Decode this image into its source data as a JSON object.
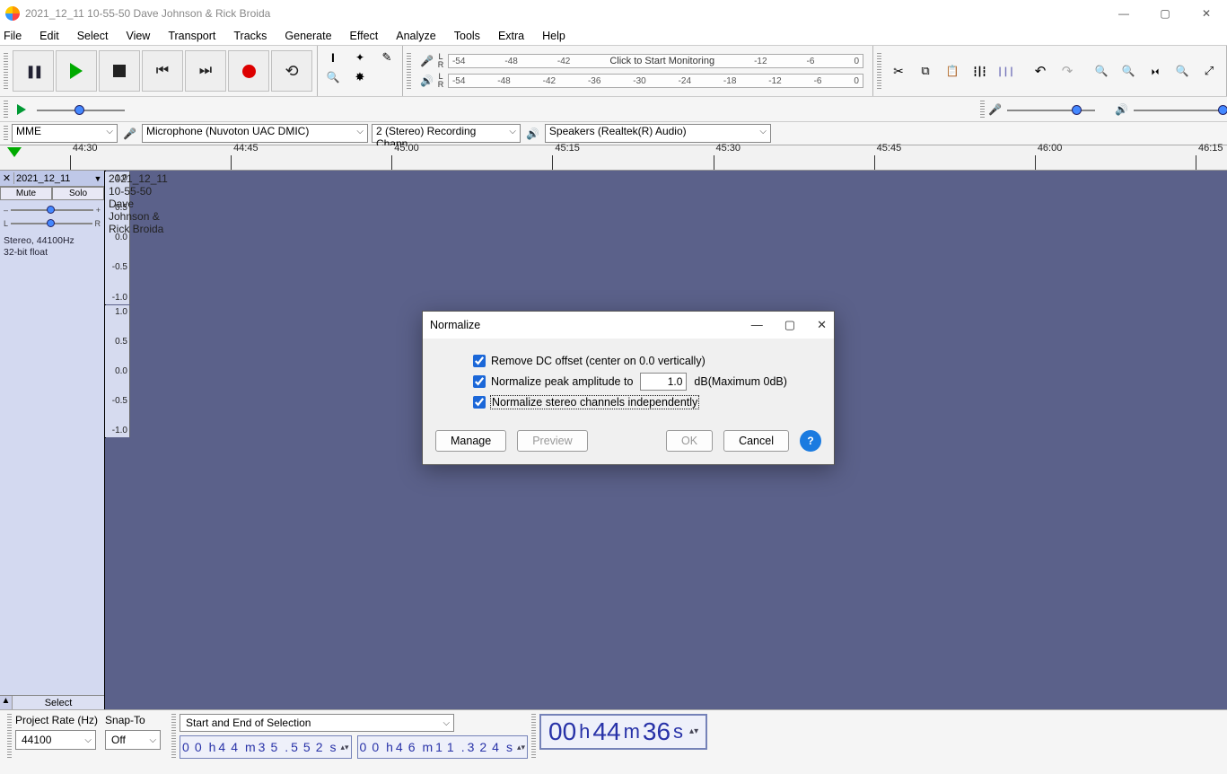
{
  "title": "2021_12_11 10-55-50 Dave  Johnson  & Rick Broida",
  "menu": [
    "File",
    "Edit",
    "Select",
    "View",
    "Transport",
    "Tracks",
    "Generate",
    "Effect",
    "Analyze",
    "Tools",
    "Extra",
    "Help"
  ],
  "meter_ticks": [
    "-54",
    "-48",
    "-42",
    "-36",
    "-30",
    "-24",
    "-18",
    "-12",
    "-6",
    "0"
  ],
  "meter_prompt": "Click to Start Monitoring",
  "devices": {
    "host": "MME",
    "input": "Microphone (Nuvoton UAC DMIC)",
    "channels": "2 (Stereo) Recording Chann",
    "output": "Speakers (Realtek(R) Audio)"
  },
  "timeline": {
    "labels": [
      "44:30",
      "44:45",
      "45:00",
      "45:15",
      "45:30",
      "45:45",
      "46:00",
      "46:15"
    ]
  },
  "track": {
    "name_short": "2021_12_11",
    "title": "2021_12_11 10-55-50 Dave  Johnson  & Rick Broida",
    "mute": "Mute",
    "solo": "Solo",
    "pan_l": "L",
    "pan_r": "R",
    "info1": "Stereo, 44100Hz",
    "info2": "32-bit float",
    "select": "Select",
    "vscale": [
      "1.0",
      "0.5",
      "0.0",
      "-0.5",
      "-1.0"
    ]
  },
  "dialog": {
    "title": "Normalize",
    "opt1": "Remove DC offset (center on 0.0 vertically)",
    "opt2": "Normalize peak amplitude to",
    "opt2_value": "1.0",
    "opt2_suffix": "dB(Maximum 0dB)",
    "opt3": "Normalize stereo channels independently",
    "manage": "Manage",
    "preview": "Preview",
    "ok": "OK",
    "cancel": "Cancel"
  },
  "bottom": {
    "rate_label": "Project Rate (Hz)",
    "rate": "44100",
    "snap_label": "Snap-To",
    "snap": "Off",
    "sel_label": "Start and End of Selection",
    "sel_start": {
      "h": "00",
      "m": "44",
      "s": "35",
      "ms": "552"
    },
    "sel_end": {
      "h": "00",
      "m": "46",
      "s": "11",
      "ms": "324"
    },
    "pos": {
      "h": "00",
      "m": "44",
      "s": "36"
    }
  }
}
